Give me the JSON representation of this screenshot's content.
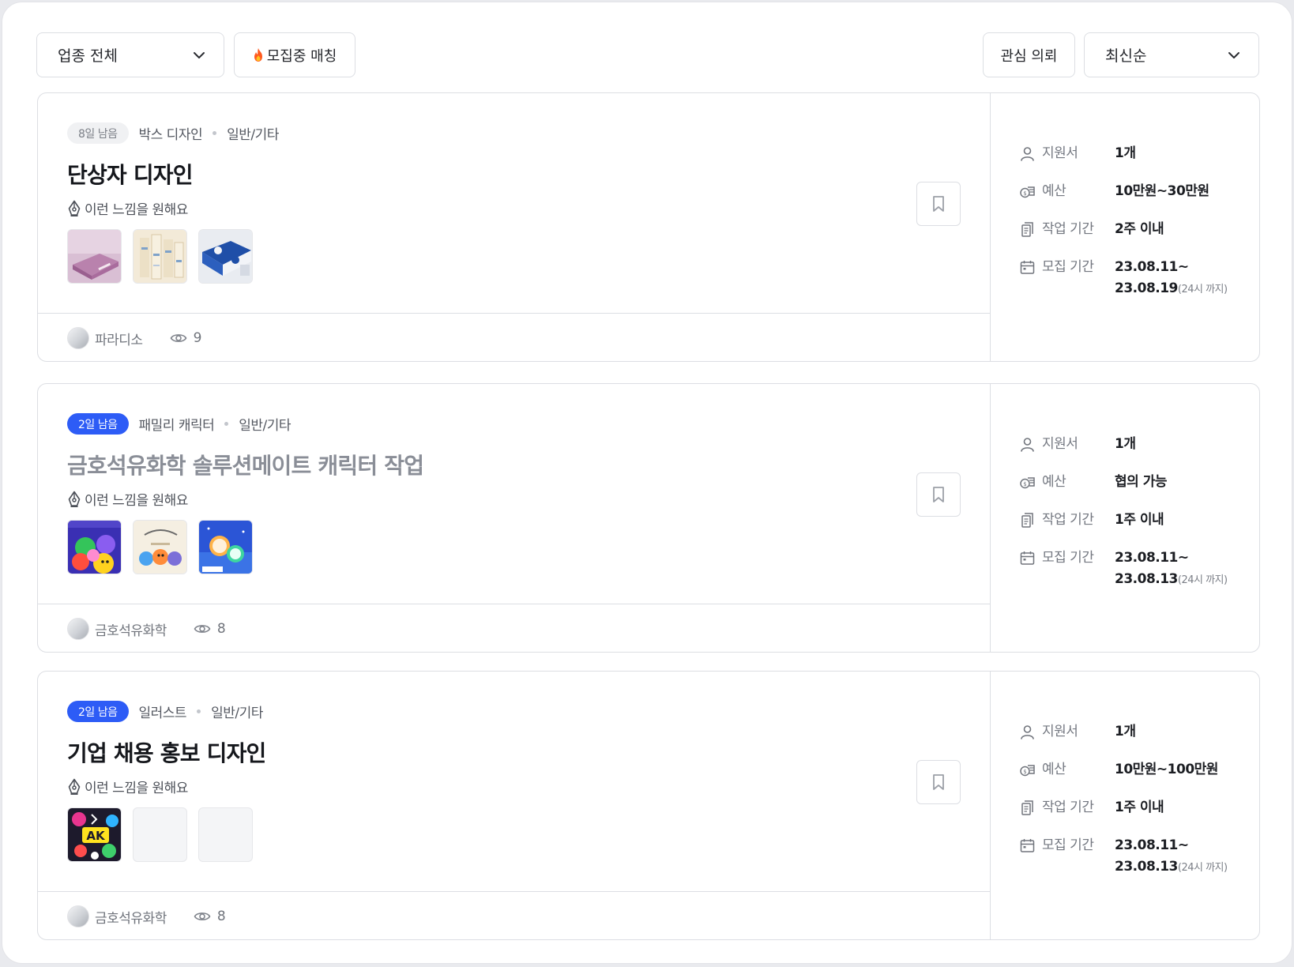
{
  "toolbar": {
    "industry_label": "업종 전체",
    "recruiting_label": "모집중 매칭",
    "interest_label": "관심 의뢰",
    "sort_label": "최신순"
  },
  "labels": {
    "feel": "이런 느낌을 원해요",
    "applicants": "지원서",
    "budget": "예산",
    "work_period": "작업 기간",
    "recruit_period": "모집 기간"
  },
  "colors": {
    "accent": "#2d5cf6",
    "badge_gray": "#f0f1f3",
    "border": "#dcdee3"
  },
  "cards": [
    {
      "badge": "8일 남음",
      "badge_style": "gray",
      "category": "박스 디자인",
      "subcategory": "일반/기타",
      "title": "단상자 디자인",
      "title_muted": false,
      "company": "파라디소",
      "views": "9",
      "applicants": "1개",
      "budget": "10만원~30만원",
      "work_period": "2주 이내",
      "recruit_start": "23.08.11~",
      "recruit_end": "23.08.19",
      "recruit_note": "(24시 까지)",
      "thumbs": [
        "pink-box",
        "cream-pattern",
        "blue-package"
      ]
    },
    {
      "badge": "2일 남음",
      "badge_style": "blue",
      "category": "패밀리 캐릭터",
      "subcategory": "일반/기타",
      "title": "금호석유화학 솔루션메이트 캐릭터 작업",
      "title_muted": true,
      "company": "금호석유화학",
      "views": "8",
      "applicants": "1개",
      "budget": "협의 가능",
      "work_period": "1주 이내",
      "recruit_start": "23.08.11~",
      "recruit_end": "23.08.13",
      "recruit_note": "(24시 까지)",
      "thumbs": [
        "character-group",
        "character-cream",
        "character-blue"
      ]
    },
    {
      "badge": "2일 남음",
      "badge_style": "blue",
      "category": "일러스트",
      "subcategory": "일반/기타",
      "title": "기업 채용 홍보 디자인",
      "title_muted": false,
      "company": "금호석유화학",
      "views": "8",
      "applicants": "1개",
      "budget": "10만원~100만원",
      "work_period": "1주 이내",
      "recruit_start": "23.08.11~",
      "recruit_end": "23.08.13",
      "recruit_note": "(24시 까지)",
      "thumbs": [
        "colorful-illustration",
        "empty",
        "empty"
      ]
    }
  ]
}
